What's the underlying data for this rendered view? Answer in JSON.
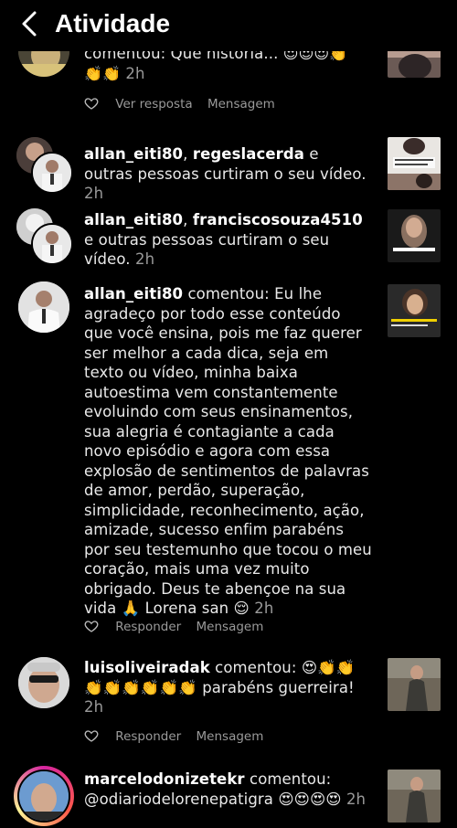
{
  "header": {
    "title": "Atividade"
  },
  "items": [
    {
      "top_text": "comentou: Que história...",
      "top_emojis": "😍😍😍👏",
      "second_line_emojis": "👏👏",
      "time": "2h",
      "actions": [
        "Ver resposta",
        "Mensagem"
      ]
    },
    {
      "user1": "allan_eiti80",
      "user2": "regeslacerda",
      "rest": " e outras pessoas curtiram o seu vídeo.",
      "time": "2h"
    },
    {
      "user1": "allan_eiti80",
      "user2": "franciscosouza4510",
      "rest": " e outras pessoas curtiram o seu vídeo.",
      "time": "2h"
    },
    {
      "user": "allan_eiti80",
      "comment": " comentou: Eu lhe agradeço por todo esse conteúdo que você ensina, pois me faz querer ser melhor a cada dica, seja em texto ou vídeo, minha baixa autoestima vem constantemente evoluindo com seus ensinamentos, sua alegria é contagiante a cada novo episódio e agora com essa explosão de sentimentos de palavras de amor, perdão, superação, simplicidade, reconhecimento, ação, amizade, sucesso enfim parabéns por seu testemunho que tocou o meu coração, mais uma vez muito obrigado. Deus te abençoe na sua vida 🙏 Lorena san 😌",
      "time": "2h",
      "actions": [
        "Responder",
        "Mensagem"
      ]
    },
    {
      "user": "luisoliveiradak",
      "comment": " comentou: 😍👏👏👏👏👏👏👏👏 parabéns guerreira!",
      "time": "2h",
      "actions": [
        "Responder",
        "Mensagem"
      ]
    },
    {
      "user": "marcelodonizetekr",
      "comment": " comentou: @odiariodelorenepatigra 😍😍😍😍",
      "time": "2h"
    }
  ],
  "colors": {
    "background": "#000000",
    "text": "#e9e9e9",
    "muted": "#9a9a9a"
  }
}
